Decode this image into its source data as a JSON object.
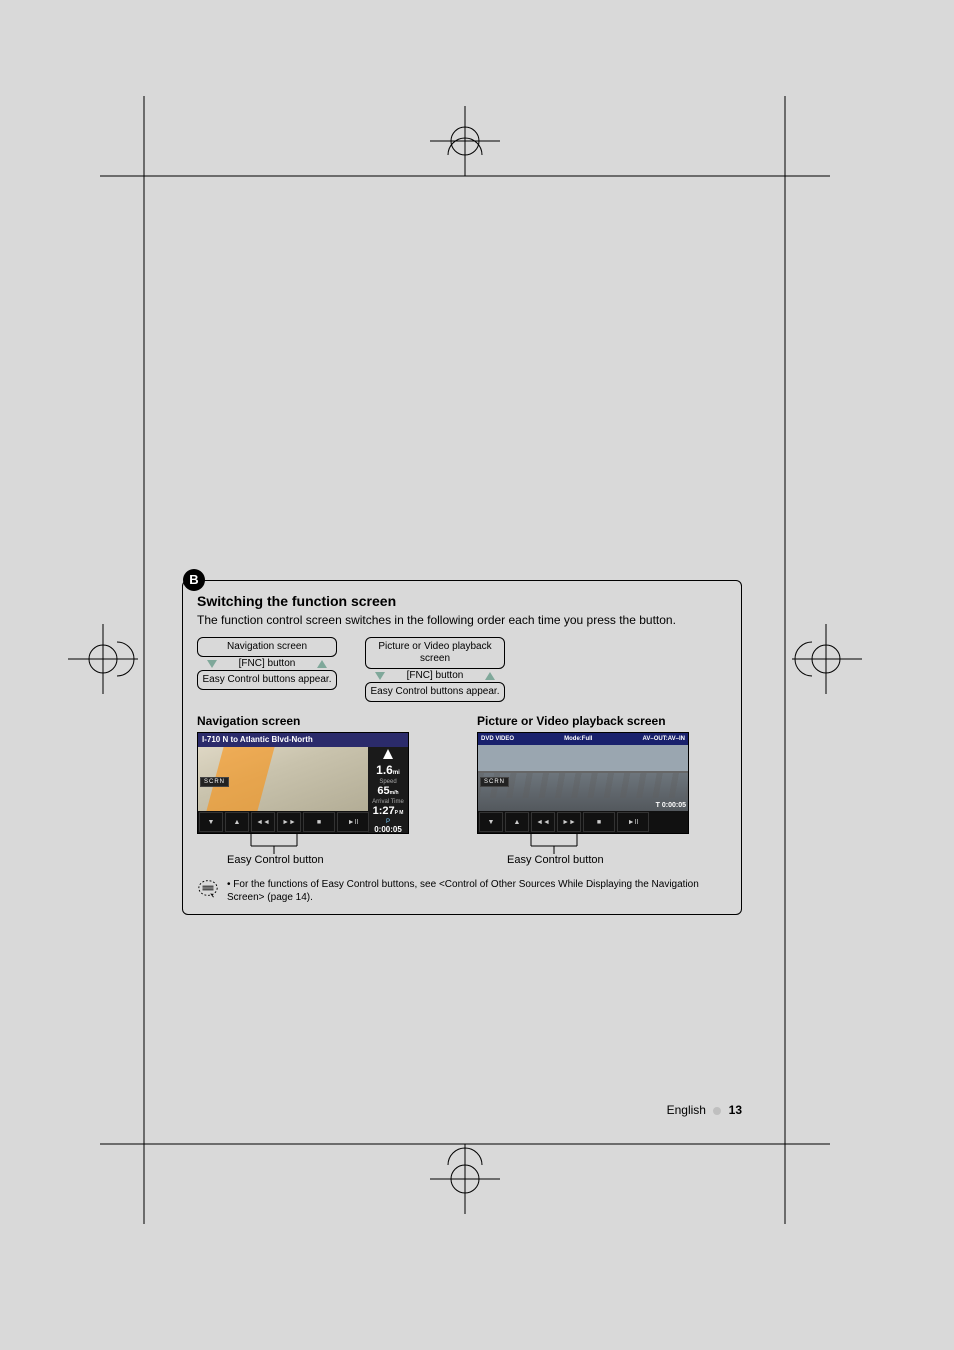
{
  "section": {
    "badge": "B",
    "title": "Switching the function screen",
    "description": "The function control screen switches in the following order each time you press the button."
  },
  "flows": [
    {
      "top": "Navigation screen",
      "mid": "[FNC] button",
      "bottom": "Easy Control buttons appear."
    },
    {
      "top": "Picture or Video playback screen",
      "mid": "[FNC] button",
      "bottom": "Easy Control buttons appear."
    }
  ],
  "screens": {
    "navigation": {
      "label": "Navigation screen",
      "title_bar": "I-710 N to Atlantic Blvd-North",
      "distance": "1.6",
      "distance_unit": "mi",
      "speed_label": "Speed",
      "speed": "65",
      "speed_unit": "m/h",
      "arrival_label": "Arrival Time",
      "arrival": "1:27",
      "arrival_unit": "P M",
      "p_label": "P",
      "time": "0:00:05",
      "scrn": "SCRN",
      "callout": "Easy Control button"
    },
    "video": {
      "label": "Picture or Video playback screen",
      "top_left": "DVD VIDEO",
      "top_mid": "Mode:Full",
      "top_right": "AV–OUT:AV–IN",
      "time": "0:00:05",
      "scrn": "SCRN",
      "callout": "Easy Control button"
    }
  },
  "note": "For the functions of Easy Control buttons, see <Control of Other Sources While Displaying the Navigation Screen> (page 14).",
  "footer": {
    "lang": "English",
    "page": "13"
  }
}
